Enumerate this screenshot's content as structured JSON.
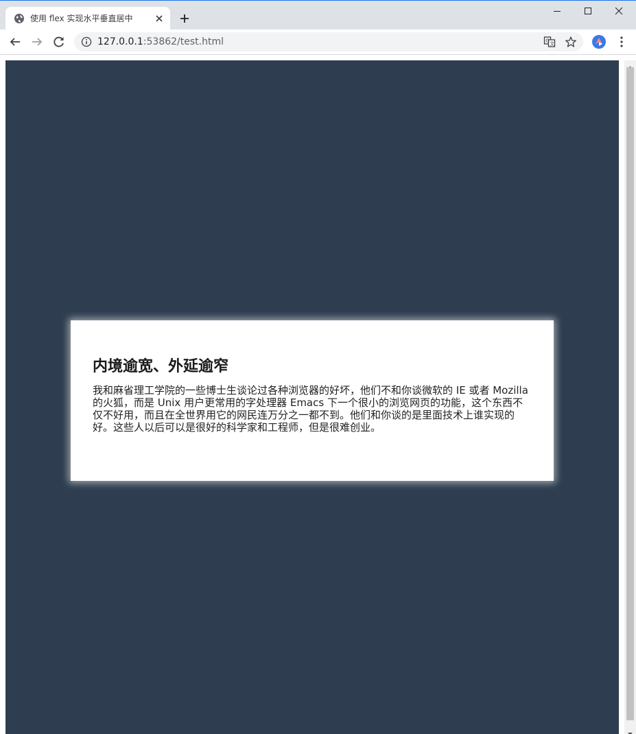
{
  "browser": {
    "tab": {
      "title": "使用 flex 实现水平垂直居中",
      "favicon": "globe-icon",
      "close_icon": "close-icon"
    },
    "new_tab_icon": "plus-icon",
    "window_controls": [
      "minimize-icon",
      "maximize-icon",
      "close-icon"
    ],
    "navigation": {
      "back_icon": "arrow-left-icon",
      "forward_icon": "arrow-right-icon",
      "reload_icon": "reload-icon"
    },
    "address_bar": {
      "info_icon": "info-icon",
      "url_host": "127.0.0.1",
      "url_rest": ":53862/test.html",
      "translate_icon": "translate-icon",
      "bookmark_icon": "star-icon"
    },
    "extension_icon": "extension-avatar-icon",
    "menu_icon": "more-vertical-icon"
  },
  "page": {
    "background_color": "#2e3d4f",
    "card": {
      "title": "内境逾宽、外延逾窄",
      "text": "我和麻省理工学院的一些博士生谈论过各种浏览器的好坏，他们不和你谈微软的 IE 或者 Mozilla 的火狐，而是 Unix 用户更常用的字处理器 Emacs 下一个很小的浏览网页的功能，这个东西不仅不好用，而且在全世界用它的网民连万分之一都不到。他们和你谈的是里面技术上谁实现的好。这些人以后可以是很好的科学家和工程师，但是很难创业。"
    }
  }
}
